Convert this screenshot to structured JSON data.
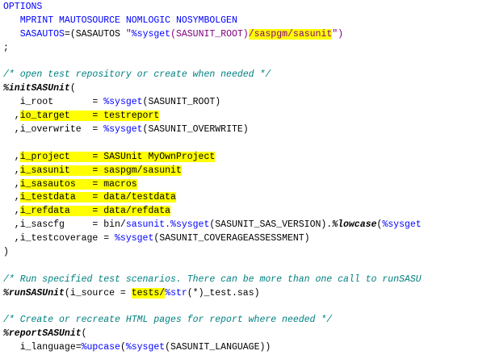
{
  "editor": {
    "lines": [
      [
        {
          "t": "OPTIONS",
          "s": "keyword"
        }
      ],
      [
        {
          "t": "   "
        },
        {
          "t": "MPRINT MAUTOSOURCE NOMLOGIC NOSYMBOLGEN",
          "s": "keyword"
        }
      ],
      [
        {
          "t": "   "
        },
        {
          "t": "SASAUTOS",
          "s": "keyword"
        },
        {
          "t": "=(SASAUTOS "
        },
        {
          "t": "\"",
          "s": "string"
        },
        {
          "t": "%sysget",
          "s": "func"
        },
        {
          "t": "(SASUNIT_ROOT)",
          "s": "string"
        },
        {
          "t": "/saspgm/sasunit",
          "s": "string",
          "h": true
        },
        {
          "t": "\")",
          "s": "string"
        }
      ],
      [
        {
          "t": ";"
        }
      ],
      [
        {
          "t": ""
        }
      ],
      [
        {
          "t": "/* open test repository or create when needed */",
          "s": "comment"
        }
      ],
      [
        {
          "t": "%initSASUnit",
          "s": "macro"
        },
        {
          "t": "("
        }
      ],
      [
        {
          "t": "   i_root       = "
        },
        {
          "t": "%sysget",
          "s": "func"
        },
        {
          "t": "(SASUNIT_ROOT)"
        }
      ],
      [
        {
          "t": "  ,"
        },
        {
          "t": "io_target    = testreport",
          "h": true
        }
      ],
      [
        {
          "t": "  ,i_overwrite  = "
        },
        {
          "t": "%sysget",
          "s": "func"
        },
        {
          "t": "(SASUNIT_OVERWRITE)"
        }
      ],
      [
        {
          "t": ""
        }
      ],
      [
        {
          "t": "  ,"
        },
        {
          "t": "i_project    = SASUnit MyOwnProject",
          "h": true
        }
      ],
      [
        {
          "t": "  ,"
        },
        {
          "t": "i_sasunit    = saspgm/sasunit",
          "h": true
        }
      ],
      [
        {
          "t": "  ,"
        },
        {
          "t": "i_sasautos   = macros",
          "h": true
        }
      ],
      [
        {
          "t": "  ,"
        },
        {
          "t": "i_testdata   = data/testdata",
          "h": true
        }
      ],
      [
        {
          "t": "  ,"
        },
        {
          "t": "i_refdata    = data/refdata",
          "h": true
        }
      ],
      [
        {
          "t": "  ,i_sascfg     = bin/"
        },
        {
          "t": "sasunit.",
          "s": "func"
        },
        {
          "t": "%sysget",
          "s": "func"
        },
        {
          "t": "(SASUNIT_SAS_VERSION)."
        },
        {
          "t": "%lowcase",
          "s": "macro"
        },
        {
          "t": "("
        },
        {
          "t": "%sysget",
          "s": "func"
        }
      ],
      [
        {
          "t": "  ,i_testcoverage = "
        },
        {
          "t": "%sysget",
          "s": "func"
        },
        {
          "t": "(SASUNIT_COVERAGEASSESSMENT)"
        }
      ],
      [
        {
          "t": ")"
        }
      ],
      [
        {
          "t": ""
        }
      ],
      [
        {
          "t": "/* Run specified test scenarios. There can be more than one call to runSASU",
          "s": "comment"
        }
      ],
      [
        {
          "t": "%runSASUnit",
          "s": "macro"
        },
        {
          "t": "(i_source = "
        },
        {
          "t": "tests/",
          "h": true
        },
        {
          "t": "%str",
          "s": "func"
        },
        {
          "t": "(*)_test.sas)"
        }
      ],
      [
        {
          "t": ""
        }
      ],
      [
        {
          "t": "/* Create or recreate HTML pages for report where needed */",
          "s": "comment"
        }
      ],
      [
        {
          "t": "%reportSASUnit",
          "s": "macro"
        },
        {
          "t": "("
        }
      ],
      [
        {
          "t": "   i_language="
        },
        {
          "t": "%upcase",
          "s": "func"
        },
        {
          "t": "("
        },
        {
          "t": "%sysget",
          "s": "func"
        },
        {
          "t": "(SASUNIT_LANGUAGE))"
        }
      ]
    ]
  },
  "colors": {
    "keyword": "#0000ff",
    "comment": "#008080",
    "macro": "#000000",
    "func": "#0000ff",
    "string": "#800080",
    "highlight": "#ffff00"
  }
}
